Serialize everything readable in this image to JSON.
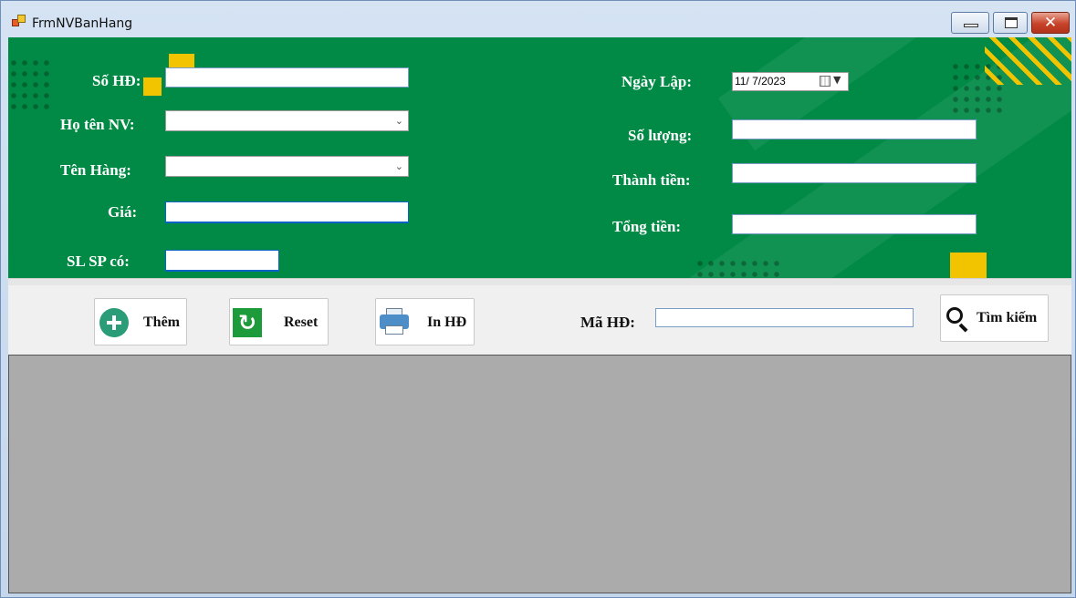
{
  "window": {
    "title": "FrmNVBanHang",
    "close_glyph": "✕"
  },
  "form": {
    "so_hd_label": "Số HĐ:",
    "ho_ten_nv_label": "Họ tên NV:",
    "ten_hang_label": "Tên Hàng:",
    "gia_label": "Giá:",
    "sl_sp_co_label": "SL SP có:",
    "ngay_lap_label": "Ngày Lập:",
    "ngay_lap_value": "11/  7/2023",
    "so_luong_label": "Số lượng:",
    "thanh_tien_label": "Thành tiền:",
    "tong_tien_label": "Tổng tiền:",
    "so_hd_value": "",
    "gia_value": "",
    "sl_sp_co_value": "",
    "so_luong_value": "",
    "thanh_tien_value": "",
    "tong_tien_value": ""
  },
  "toolbar": {
    "them_label": "Thêm",
    "reset_label": "Reset",
    "reset_glyph": "↻",
    "in_hd_label": "In HĐ",
    "ma_hd_label": "Mã HĐ:",
    "ma_hd_value": "",
    "tim_kiem_label": "Tìm kiếm"
  },
  "colors": {
    "panel_green": "#008a45",
    "accent_yellow": "#f2c400",
    "grid_gray": "#ababab"
  },
  "icons": [
    "app-icon",
    "minimize-icon",
    "maximize-icon",
    "close-icon",
    "calendar-icon",
    "chevron-down-icon",
    "plus-icon",
    "reset-icon",
    "printer-icon",
    "search-icon"
  ]
}
